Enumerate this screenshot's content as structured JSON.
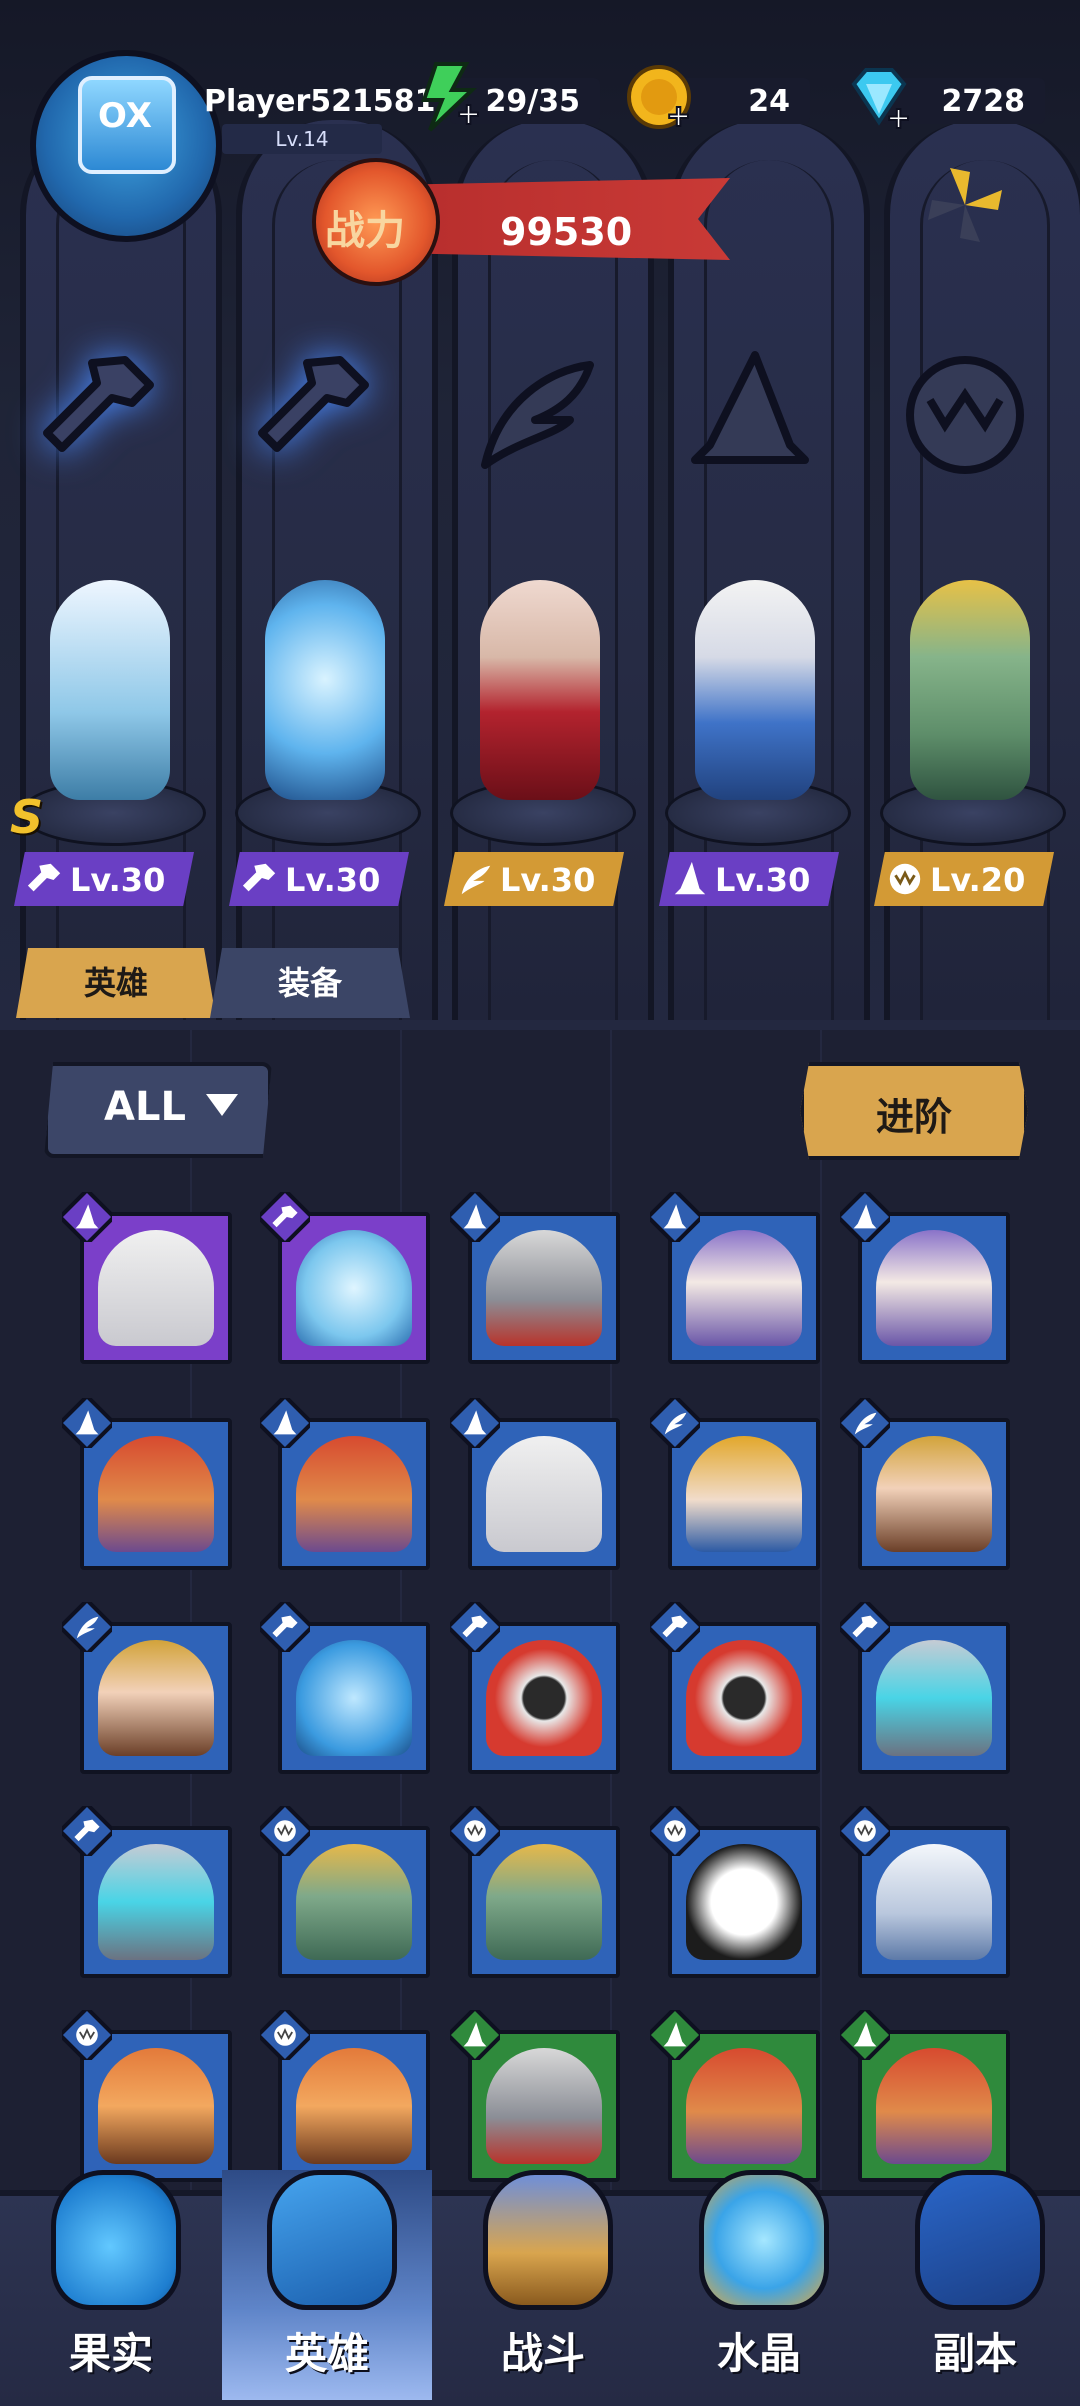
{
  "header": {
    "player_name": "Player521581",
    "player_level": "Lv.14",
    "energy": "29/35",
    "gold": "24",
    "gems": "2728",
    "power_label": "战力",
    "power_value": "99530"
  },
  "class_emblems": [
    "wrench",
    "wrench",
    "wing",
    "wizard-hat",
    "beast-claw"
  ],
  "team": [
    {
      "hero": "robot-diver",
      "level": "Lv.30",
      "class": "wrench",
      "rank": "S"
    },
    {
      "hero": "glass-capsule-spirit",
      "level": "Lv.30",
      "class": "wrench"
    },
    {
      "hero": "vampire-lady",
      "level": "Lv.30",
      "class": "wing"
    },
    {
      "hero": "frost-wizard",
      "level": "Lv.30",
      "class": "wizard-hat"
    },
    {
      "hero": "medusa",
      "level": "Lv.20",
      "class": "beast-claw"
    }
  ],
  "tabs": {
    "heroes": "英雄",
    "equipment": "装备"
  },
  "filter": {
    "all_label": "ALL",
    "advance_label": "进阶"
  },
  "roster": [
    {
      "hero": "old-wizard",
      "class": "wizard-hat",
      "frame": "purple"
    },
    {
      "hero": "glass-spirit",
      "class": "wrench",
      "frame": "purple"
    },
    {
      "hero": "armored-knight",
      "class": "wizard-hat",
      "frame": "blue"
    },
    {
      "hero": "blind-nun",
      "class": "wizard-hat",
      "frame": "blue"
    },
    {
      "hero": "blind-nun",
      "class": "wizard-hat",
      "frame": "blue"
    },
    {
      "hero": "red-hat-gnome",
      "class": "wizard-hat",
      "frame": "blue"
    },
    {
      "hero": "red-hat-gnome",
      "class": "wizard-hat",
      "frame": "blue"
    },
    {
      "hero": "old-wizard",
      "class": "wizard-hat",
      "frame": "blue"
    },
    {
      "hero": "pharaoh-queen",
      "class": "wing",
      "frame": "blue"
    },
    {
      "hero": "laurel-maiden",
      "class": "wing",
      "frame": "blue"
    },
    {
      "hero": "laurel-maiden",
      "class": "wing",
      "frame": "blue"
    },
    {
      "hero": "fishbowl-bot",
      "class": "wrench",
      "frame": "blue"
    },
    {
      "hero": "red-diver-bot",
      "class": "wrench",
      "frame": "blue"
    },
    {
      "hero": "red-diver-bot",
      "class": "wrench",
      "frame": "blue"
    },
    {
      "hero": "crystal-chest",
      "class": "wrench",
      "frame": "blue"
    },
    {
      "hero": "crystal-chest",
      "class": "wrench",
      "frame": "blue"
    },
    {
      "hero": "gorgon",
      "class": "beast-claw",
      "frame": "blue"
    },
    {
      "hero": "gorgon",
      "class": "beast-claw",
      "frame": "blue"
    },
    {
      "hero": "panda-fighter",
      "class": "beast-claw",
      "frame": "blue"
    },
    {
      "hero": "white-tiger",
      "class": "beast-claw",
      "frame": "blue"
    },
    {
      "hero": "fox-warrior",
      "class": "beast-claw",
      "frame": "blue"
    },
    {
      "hero": "fox-warrior",
      "class": "beast-claw",
      "frame": "blue"
    },
    {
      "hero": "armored-knight",
      "class": "wizard-hat",
      "frame": "green"
    },
    {
      "hero": "red-hat-gnome",
      "class": "wizard-hat",
      "frame": "green"
    },
    {
      "hero": "red-hat-gnome",
      "class": "wizard-hat",
      "frame": "green"
    }
  ],
  "nav": [
    {
      "label": "果实",
      "icon": "fruit-icon",
      "active": false
    },
    {
      "label": "英雄",
      "icon": "hero-icon",
      "active": true
    },
    {
      "label": "战斗",
      "icon": "battle-icon",
      "active": false
    },
    {
      "label": "水晶",
      "icon": "crystal-icon",
      "active": false
    },
    {
      "label": "副本",
      "icon": "dungeon-flag-icon",
      "active": false
    }
  ],
  "colors": {
    "frame_purple": "#7b3fc9",
    "frame_blue": "#2f63b8",
    "frame_green": "#2f8a3c",
    "gold_accent": "#d9a54e",
    "power_red": "#c93a36"
  }
}
